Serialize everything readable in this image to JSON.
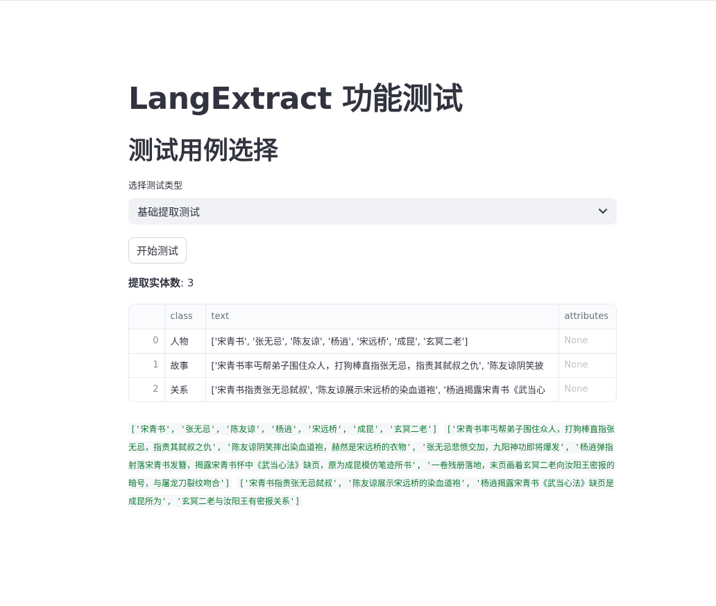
{
  "title": "LangExtract 功能测试",
  "section_title": "测试用例选择",
  "select": {
    "label": "选择测试类型",
    "value": "基础提取测试"
  },
  "run_button": "开始测试",
  "count": {
    "label": "提取实体数",
    "separator": ":",
    "value": "3"
  },
  "table": {
    "headers": [
      "",
      "class",
      "text",
      "attributes"
    ],
    "rows": [
      {
        "index": "0",
        "class": "人物",
        "text": "['宋青书', '张无忌', '陈友谅', '杨逍', '宋远桥', '成昆', '玄冥二老']",
        "attributes": "None"
      },
      {
        "index": "1",
        "class": "故事",
        "text": "['宋青书率丐帮弟子围住众人，打狗棒直指张无忌，指责其弑叔之仇', '陈友谅阴笑披",
        "attributes": "None"
      },
      {
        "index": "2",
        "class": "关系",
        "text": "['宋青书指责张无忌弑叔', '陈友谅展示宋远桥的染血道袍', '杨逍揭露宋青书《武当心",
        "attributes": "None"
      }
    ]
  },
  "output_lines": [
    "['宋青书', '张无忌', '陈友谅', '杨逍', '宋远桥', '成昆', '玄冥二老']",
    "['宋青书率丐帮弟子围住众人，打狗棒直指张无忌，指责其弑叔之仇', '陈友谅阴笑摔出染血道袍，赫然是宋远桥的衣物', '张无忌悲愤交加，九阳神功即将爆发', '杨逍弹指射落宋青书发簪，揭露宋青书怀中《武当心法》缺页，原为成昆模仿笔迹所书', '一卷残册落地，末页画着玄冥二老向汝阳王密报的暗号，与屠龙刀裂纹吻合']",
    "['宋青书指责张无忌弑叔', '陈友谅展示宋远桥的染血道袍', '杨逍揭露宋青书《武当心法》缺页是成昆所为', '玄冥二老与汝阳王有密报关系']"
  ]
}
